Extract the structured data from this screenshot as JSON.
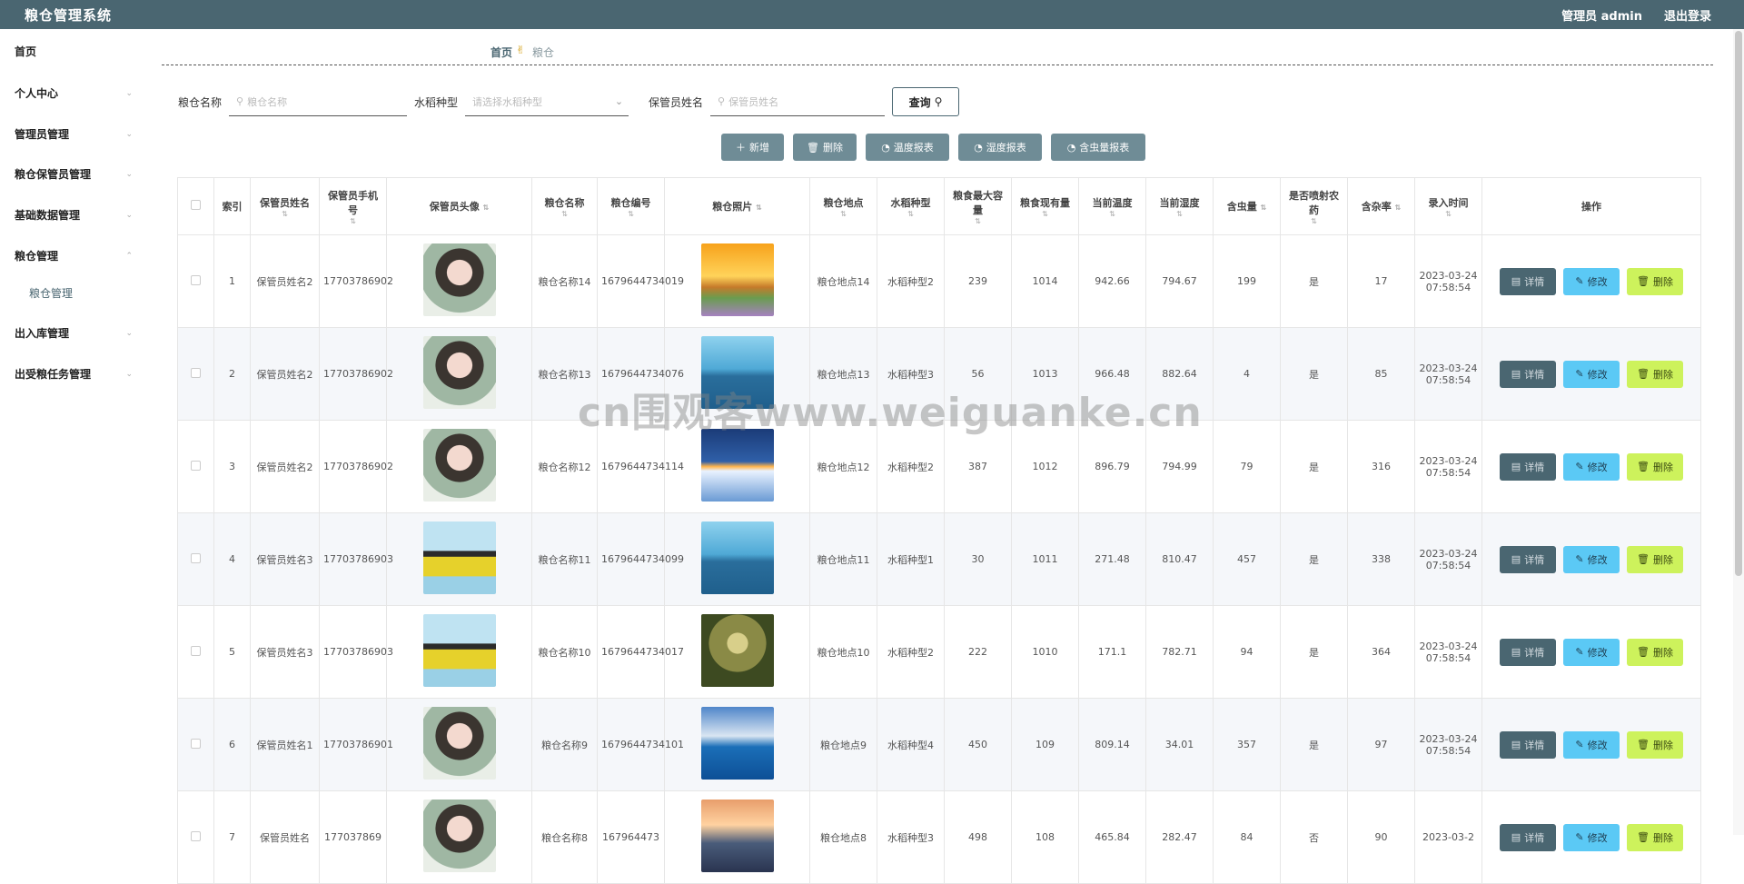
{
  "app": {
    "title": "粮仓管理系统",
    "user": "管理员 admin",
    "logout": "退出登录"
  },
  "sidebar": {
    "items": [
      {
        "label": "首页"
      },
      {
        "label": "个人中心"
      },
      {
        "label": "管理员管理"
      },
      {
        "label": "粮仓保管员管理"
      },
      {
        "label": "基础数据管理"
      },
      {
        "label": "粮仓管理"
      },
      {
        "label": "出入库管理"
      },
      {
        "label": "出受粮任务管理"
      }
    ],
    "subitems": [
      {
        "label": "粮仓管理"
      }
    ]
  },
  "breadcrumb": {
    "home": "首页",
    "current": "粮仓"
  },
  "search": {
    "name_label": "粮仓名称",
    "name_placeholder": "粮仓名称",
    "type_label": "水稻种型",
    "type_placeholder": "请选择水稻种型",
    "keeper_label": "保管员姓名",
    "keeper_placeholder": "保管员姓名",
    "query": "查询"
  },
  "actions": {
    "add": "新增",
    "delete": "删除",
    "temp_report": "温度报表",
    "humid_report": "湿度报表",
    "pest_report": "含虫量报表"
  },
  "table": {
    "headers": [
      "索引",
      "保管员姓名",
      "保管员手机号",
      "保管员头像",
      "粮仓名称",
      "粮仓编号",
      "粮仓照片",
      "粮仓地点",
      "水稻种型",
      "粮食最大容量",
      "粮食现有量",
      "当前温度",
      "当前湿度",
      "含虫量",
      "是否喷射农药",
      "含杂率",
      "录入时间",
      "操作"
    ],
    "rows": [
      {
        "idx": "1",
        "keeper": "保管员姓名2",
        "phone": "17703786902",
        "avatar": "av-a",
        "name": "粮仓名称14",
        "code": "1679644734019",
        "photo": "p-sunset",
        "place": "粮仓地点14",
        "type": "水稻种型2",
        "max": "239",
        "now": "1014",
        "temp": "942.66",
        "humid": "794.67",
        "pest": "199",
        "spray": "是",
        "impurity": "17",
        "time": "2023-03-24 07:58:54"
      },
      {
        "idx": "2",
        "keeper": "保管员姓名2",
        "phone": "17703786902",
        "avatar": "av-a",
        "name": "粮仓名称13",
        "code": "1679644734076",
        "photo": "p-lake",
        "place": "粮仓地点13",
        "type": "水稻种型3",
        "max": "56",
        "now": "1013",
        "temp": "966.48",
        "humid": "882.64",
        "pest": "4",
        "spray": "是",
        "impurity": "85",
        "time": "2023-03-24 07:58:54"
      },
      {
        "idx": "3",
        "keeper": "保管员姓名2",
        "phone": "17703786902",
        "avatar": "av-a",
        "name": "粮仓名称12",
        "code": "1679644734114",
        "photo": "p-snow",
        "place": "粮仓地点12",
        "type": "水稻种型2",
        "max": "387",
        "now": "1012",
        "temp": "896.79",
        "humid": "794.99",
        "pest": "79",
        "spray": "是",
        "impurity": "316",
        "time": "2023-03-24 07:58:54"
      },
      {
        "idx": "4",
        "keeper": "保管员姓名3",
        "phone": "17703786903",
        "avatar": "av-b",
        "name": "粮仓名称11",
        "code": "1679644734099",
        "photo": "p-lake",
        "place": "粮仓地点11",
        "type": "水稻种型1",
        "max": "30",
        "now": "1011",
        "temp": "271.48",
        "humid": "810.47",
        "pest": "457",
        "spray": "是",
        "impurity": "338",
        "time": "2023-03-24 07:58:54"
      },
      {
        "idx": "5",
        "keeper": "保管员姓名3",
        "phone": "17703786903",
        "avatar": "av-b",
        "name": "粮仓名称10",
        "code": "1679644734017",
        "photo": "p-forest",
        "place": "粮仓地点10",
        "type": "水稻种型2",
        "max": "222",
        "now": "1010",
        "temp": "171.1",
        "humid": "782.71",
        "pest": "94",
        "spray": "是",
        "impurity": "364",
        "time": "2023-03-24 07:58:54"
      },
      {
        "idx": "6",
        "keeper": "保管员姓名1",
        "phone": "17703786901",
        "avatar": "av-a",
        "name": "粮仓名称9",
        "code": "1679644734101",
        "photo": "p-sea",
        "place": "粮仓地点9",
        "type": "水稻种型4",
        "max": "450",
        "now": "109",
        "temp": "809.14",
        "humid": "34.01",
        "pest": "357",
        "spray": "是",
        "impurity": "97",
        "time": "2023-03-24 07:58:54"
      },
      {
        "idx": "7",
        "keeper": "保管员姓名",
        "phone": "177037869",
        "avatar": "av-a",
        "name": "粮仓名称8",
        "code": "167964473",
        "photo": "p-mountain",
        "place": "粮仓地点8",
        "type": "水稻种型3",
        "max": "498",
        "now": "108",
        "temp": "465.84",
        "humid": "282.47",
        "pest": "84",
        "spray": "否",
        "impurity": "90",
        "time": "2023-03-2"
      }
    ],
    "op_detail": "详情",
    "op_edit": "修改",
    "op_delete": "删除"
  },
  "watermark": "cn围观客www.weiguanke.cn"
}
